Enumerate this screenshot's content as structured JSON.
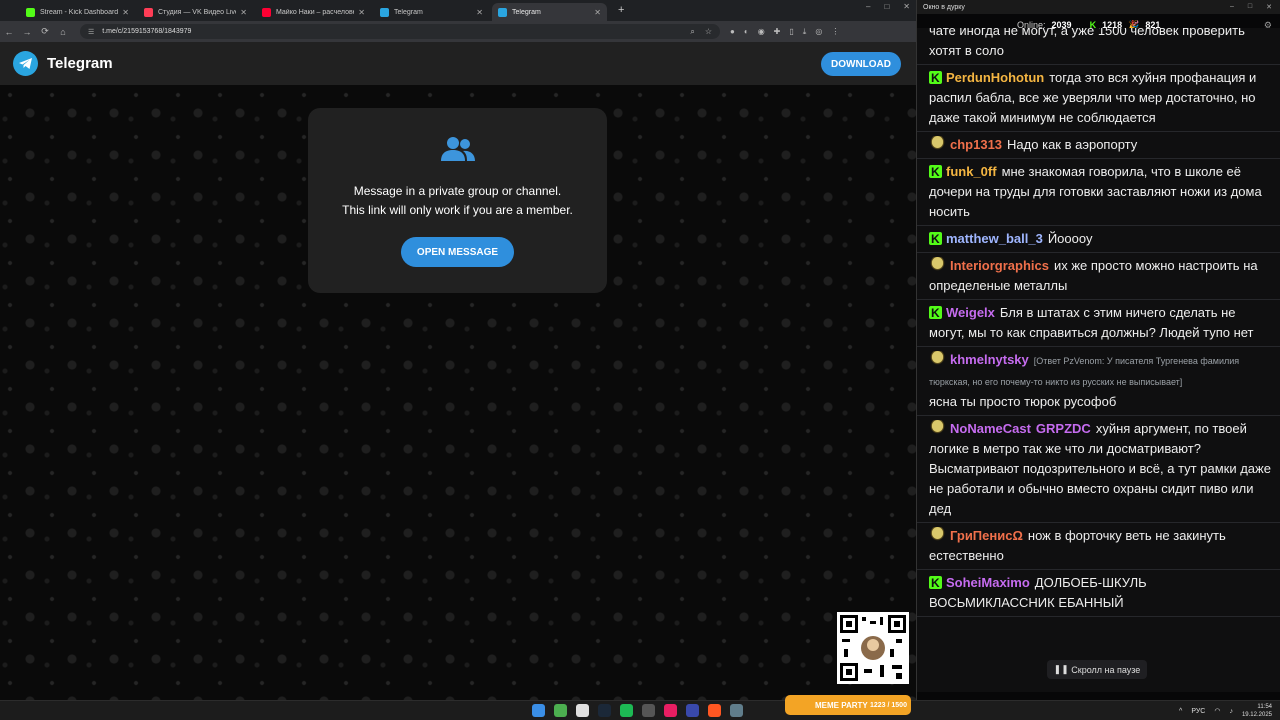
{
  "browser": {
    "tabs": [
      {
        "title": "Stream - Kick Dashboard",
        "color": "#53fc18",
        "active": false
      },
      {
        "title": "Студия — VK Видео Live",
        "color": "#ff3d56",
        "active": false
      },
      {
        "title": "Майко Наки – расчеловечив...",
        "color": "#ff0033",
        "active": false
      },
      {
        "title": "Telegram",
        "color": "#2aa5e0",
        "active": false
      },
      {
        "title": "Telegram",
        "color": "#2aa5e0",
        "active": true
      }
    ],
    "new_tab": "+",
    "url": "t.me/c/2159153768/1843979"
  },
  "telegram": {
    "brand": "Telegram",
    "download_label": "DOWNLOAD",
    "message_line1": "Message in a private group or channel.",
    "message_line2": "This link will only work if you are a member.",
    "open_label": "OPEN MESSAGE",
    "accent": "#2f8fdd"
  },
  "chat": {
    "window_title": "Окно в дурку",
    "online_label": "Online:",
    "online": "2039",
    "kick_count": "1218",
    "party_count": "821",
    "messages": [
      {
        "badge": "k",
        "user": "",
        "color": "#ffffff",
        "text": "чате иногда не могут, а уже 1500 человек проверить хотят в соло"
      },
      {
        "badge": "k",
        "user": "PerdunHohotun",
        "color": "#f5b642",
        "text": "тогда это вся хуйня профанация и распил бабла, все же уверяли что мер достаточно, но даже такой минимум не соблюдается"
      },
      {
        "badge": "p",
        "user": "chp1313",
        "color": "#f0704b",
        "text": "Надо как в аэропорту"
      },
      {
        "badge": "k",
        "user": "funk_0ff",
        "color": "#f5b642",
        "text": "мне знакомая говорила, что в школе её дочери на труды для готовки заставляют ножи из дома носить"
      },
      {
        "badge": "k",
        "user": "matthew_ball_3",
        "color": "#9fb6ff",
        "text": "Йооооу"
      },
      {
        "badge": "p",
        "user": "Interiorgraphics",
        "color": "#f0704b",
        "text": "их же просто можно настроить на определеные металлы"
      },
      {
        "badge": "k",
        "user": "Weigelx",
        "color": "#c66cf0",
        "text": "Бля в штатах с этим ничего сделать не могут, мы то как справиться должны? Людей тупо нет"
      },
      {
        "badge": "p",
        "user": "khmelnytsky",
        "color": "#c66cf0",
        "reply": "[Ответ PzVenom: У писателя Тургенева фамилия тюркская, но его почему-то никто из русских не выписывает]",
        "text": "ясна ты просто тюрок русофоб"
      },
      {
        "badge": "p",
        "user": "NoNameCast",
        "user2": "GRPZDC",
        "color": "#c66cf0",
        "text": "хуйня аргумент, по твоей логике в метро так же что ли досматривают? Высматривают подозрительного и всё, а тут рамки даже не работали и обычно вместо охраны сидит пиво или дед"
      },
      {
        "badge": "p",
        "user": "ГриПенисΩ",
        "color": "#f0704b",
        "text": "нож в форточку веть не закинуть естественно"
      },
      {
        "badge": "k",
        "user": "SoheiMaximo",
        "color": "#c66cf0",
        "text": "ДОЛБОЕБ-ШКУЛЬ ВОСЬМИКЛАССНИК ЕБАННЫЙ"
      }
    ],
    "pause_label": "Скролл на паузе"
  },
  "taskbar": {
    "widget_label": "MEME PARTY",
    "widget_count": "1223 / 1500",
    "lang": "РУС",
    "time": "11:54",
    "date": "19.12.2025"
  }
}
